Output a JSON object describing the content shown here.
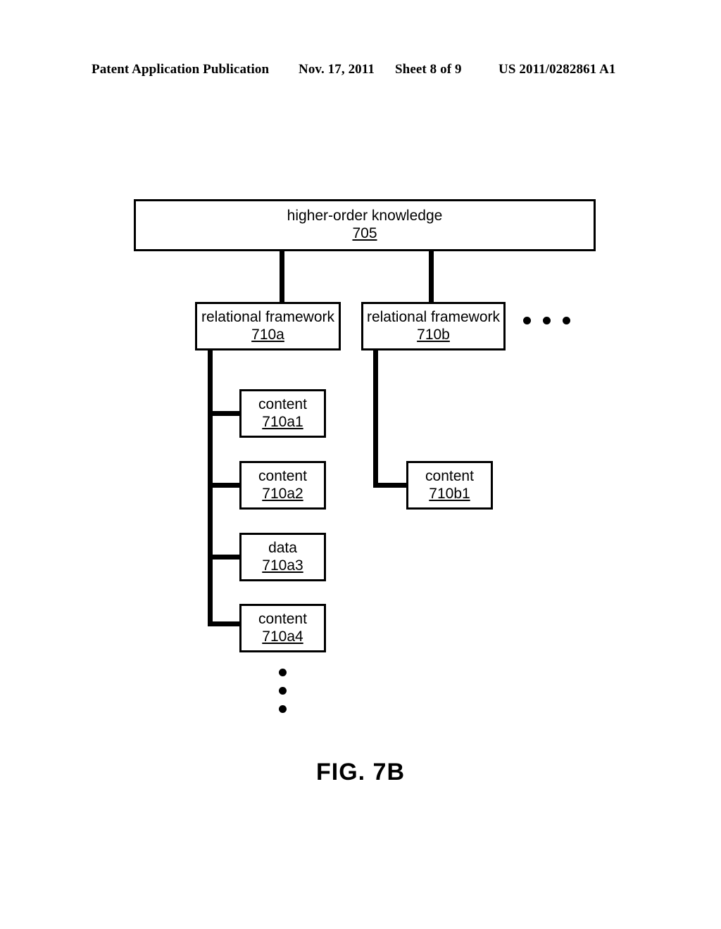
{
  "header": {
    "publication": "Patent Application Publication",
    "date": "Nov. 17, 2011",
    "sheet": "Sheet 8 of 9",
    "patent_number": "US 2011/0282861 A1"
  },
  "figure": {
    "caption": "FIG. 7B"
  },
  "diagram": {
    "root": {
      "title": "higher-order knowledge",
      "ref": "705"
    },
    "frameworks": [
      {
        "title": "relational framework",
        "ref": "710a"
      },
      {
        "title": "relational framework",
        "ref": "710b"
      }
    ],
    "framework_a_children": [
      {
        "title": "content",
        "ref": "710a1"
      },
      {
        "title": "content",
        "ref": "710a2"
      },
      {
        "title": "data",
        "ref": "710a3"
      },
      {
        "title": "content",
        "ref": "710a4"
      }
    ],
    "framework_b_children": [
      {
        "title": "content",
        "ref": "710b1"
      }
    ],
    "ellipsis_horizontal": "• • •",
    "ellipsis_vertical": "•\n•\n•"
  }
}
